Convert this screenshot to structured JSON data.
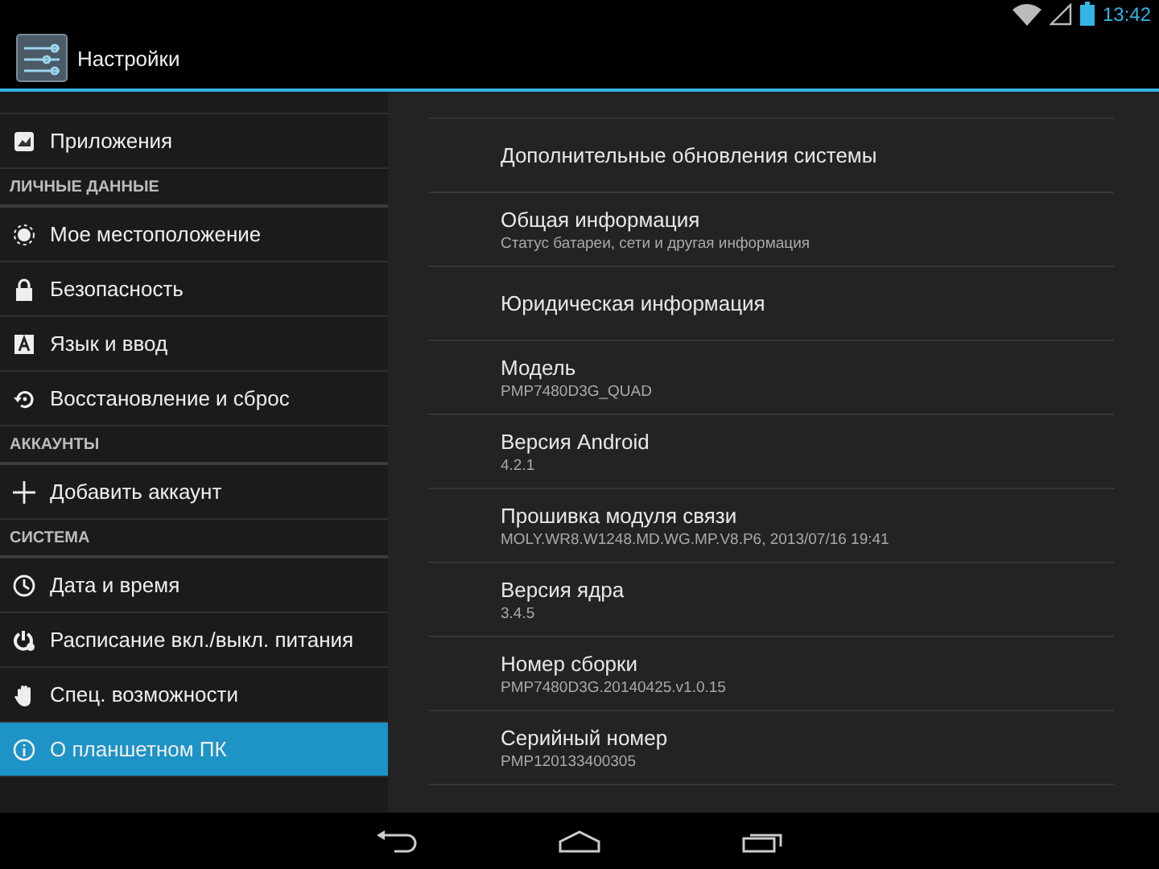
{
  "status_bar": {
    "time": "13:42"
  },
  "action_bar": {
    "title": "Настройки"
  },
  "sidebar": {
    "items": [
      {
        "kind": "item",
        "label": "Приложения",
        "selected": false
      },
      {
        "kind": "header",
        "label": "ЛИЧНЫЕ ДАННЫЕ"
      },
      {
        "kind": "item",
        "label": "Мое местоположение",
        "selected": false
      },
      {
        "kind": "item",
        "label": "Безопасность",
        "selected": false
      },
      {
        "kind": "item",
        "label": "Язык и ввод",
        "selected": false
      },
      {
        "kind": "item",
        "label": "Восстановление и сброс",
        "selected": false
      },
      {
        "kind": "header",
        "label": "АККАУНТЫ"
      },
      {
        "kind": "item",
        "label": "Добавить аккаунт",
        "selected": false
      },
      {
        "kind": "header",
        "label": "СИСТЕМА"
      },
      {
        "kind": "item",
        "label": "Дата и время",
        "selected": false
      },
      {
        "kind": "item",
        "label": "Расписание вкл./выкл. питания",
        "selected": false
      },
      {
        "kind": "item",
        "label": "Спец. возможности",
        "selected": false
      },
      {
        "kind": "item",
        "label": "О планшетном ПК",
        "selected": true
      }
    ]
  },
  "details": [
    {
      "title": "Дополнительные обновления системы"
    },
    {
      "title": "Общая информация",
      "summary": "Статус батареи, сети и другая информация"
    },
    {
      "title": "Юридическая информация"
    },
    {
      "title": "Модель",
      "summary": "PMP7480D3G_QUAD"
    },
    {
      "title": "Версия Android",
      "summary": "4.2.1"
    },
    {
      "title": "Прошивка модуля связи",
      "summary": "MOLY.WR8.W1248.MD.WG.MP.V8.P6, 2013/07/16 19:41"
    },
    {
      "title": "Версия ядра",
      "summary": "3.4.5"
    },
    {
      "title": "Номер сборки",
      "summary": "PMP7480D3G.20140425.v1.0.15"
    },
    {
      "title": "Серийный номер",
      "summary": "PMP120133400305"
    }
  ]
}
